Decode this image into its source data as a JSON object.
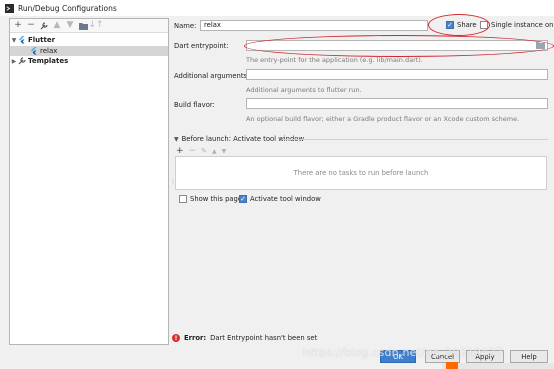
{
  "window": {
    "title": "Run/Debug Configurations"
  },
  "toolbar": {
    "icons": [
      "add-icon",
      "remove-icon",
      "wrench-icon",
      "up-arrow-icon",
      "down-arrow-icon",
      "folder-icon",
      "sort-icon"
    ]
  },
  "tree": {
    "flutter_label": "Flutter",
    "relax_label": "relax",
    "templates_label": "Templates"
  },
  "form": {
    "name_label": "Name:",
    "name_value": "relax",
    "share_label": "Share",
    "share_checked": true,
    "single_instance_label": "Single instance only",
    "dart_label": "Dart entrypoint:",
    "dart_value": "",
    "dart_hint": "The entry-point for the application (e.g. lib/main.dart).",
    "args_label": "Additional arguments:",
    "args_value": "",
    "args_hint": "Additional arguments to flutter run.",
    "flavor_label": "Build flavor:",
    "flavor_value": "",
    "flavor_hint": "An optional build flavor; either a Gradle product flavor or an Xcode custom scheme."
  },
  "before_launch": {
    "header": "Before launch: Activate tool window",
    "empty_text": "There are no tasks to run before launch",
    "show_page_label": "Show this page",
    "activate_label": "Activate tool window"
  },
  "error": {
    "label": "Error:",
    "message": "Dart Entrypoint hasn't been set"
  },
  "buttons": {
    "ok": "OK",
    "cancel": "Cancel",
    "apply": "Apply",
    "help": "Help"
  },
  "watermark": "https://blog.csdn.net/qq_30319437",
  "colors": {
    "accent": "#3d7fd0",
    "annotation": "#d0262d",
    "error": "#d9302c"
  }
}
